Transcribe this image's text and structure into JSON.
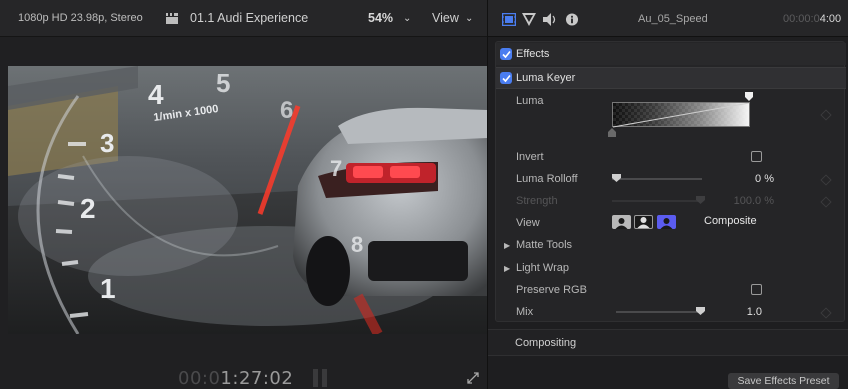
{
  "viewer": {
    "format": "1080p HD 23.98p, Stereo",
    "clip_title": "01.1 Audi Experience",
    "zoom": "54%",
    "view_menu": "View",
    "timecode_dim": "00:0",
    "timecode_bright": "1:27:02"
  },
  "inspector": {
    "clip_name": "Au_05_Speed",
    "timecode_dim": "00:00:0",
    "timecode_bright": "4:00",
    "effects_label": "Effects",
    "effect_name": "Luma Keyer",
    "params": {
      "luma": "Luma",
      "invert": "Invert",
      "luma_rolloff": "Luma Rolloff",
      "luma_rolloff_value": "0 %",
      "strength": "Strength",
      "strength_value": "100.0 %",
      "view": "View",
      "view_value": "Composite",
      "matte_tools": "Matte Tools",
      "light_wrap": "Light Wrap",
      "preserve_rgb": "Preserve RGB",
      "mix": "Mix",
      "mix_value": "1.0"
    },
    "invert_checked": false,
    "preserve_rgb_checked": false,
    "luma_rolloff_level": 0,
    "mix_level": 1.0,
    "compositing_label": "Compositing",
    "save_preset_label": "Save Effects Preset"
  },
  "colors": {
    "accent_blue": "#4a7df0",
    "view_selected": "#5b5cf0"
  }
}
